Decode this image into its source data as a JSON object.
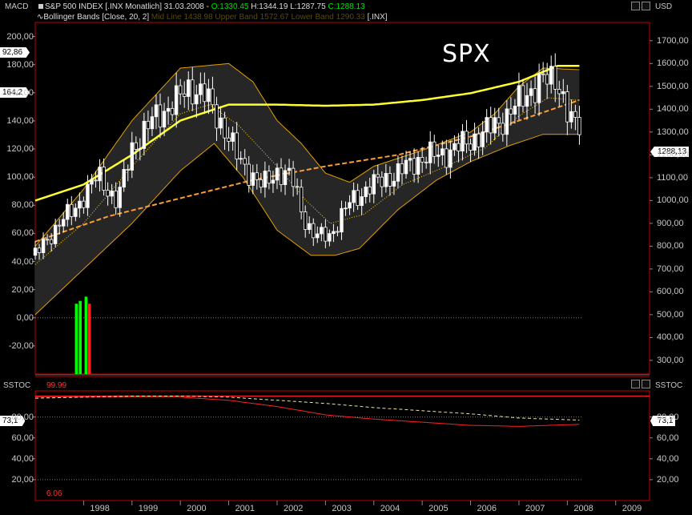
{
  "header": {
    "left_label": "MACD",
    "right_label": "USD",
    "symbol": "S&P 500 INDEX [.INX  Monatlich]",
    "date": "31.03.2008",
    "sep": "-",
    "open": "O:1330.45",
    "high": "H:1344.19",
    "low": "L:1287.75",
    "close": "C:1288.13",
    "indicator": "Bollinger Bands [Close, 20, 2]",
    "indicator_values": "Mid Line 1438.98 Upper Band 1572.67 Lower Band 1290.33",
    "indicator_sym": "[.INX]"
  },
  "chart_title": "SPX",
  "lower_panel": {
    "left_label": "SSTOC",
    "right_label": "SSTOC",
    "level_high": "99.99",
    "level_low": "6.06"
  },
  "tags": {
    "macd_top": "92,86",
    "macd_mid": "164,2",
    "price_last": "1288,13",
    "sstoc_left": "73,1",
    "sstoc_right": "73,1"
  },
  "colors": {
    "background": "#000000",
    "bb_upper": "#e0a000",
    "mid_line": "#ffd000",
    "ma_long": "#ffff30",
    "trend": "#ff9e30",
    "up_bar": "#00ff00",
    "down_bar": "#ff2020",
    "sstoc": "#ff2020",
    "sstoc_signal": "#f0e6a0"
  },
  "chart_data": [
    {
      "type": "candlestick",
      "title": "SPX",
      "xlabel": "",
      "ylabel": "USD",
      "x_ticks": [
        "1998",
        "1999",
        "2000",
        "2001",
        "2002",
        "2003",
        "2004",
        "2005",
        "2006",
        "2007",
        "2008",
        "2009"
      ],
      "y_ticks_right": [
        "1700,00",
        "1600,00",
        "1500,00",
        "1400,00",
        "1300,00",
        "1200,00",
        "1100,00",
        "1000,00",
        "900,00",
        "800,00",
        "700,00",
        "600,00",
        "500,00",
        "400,00",
        "300,00"
      ],
      "y_ticks_left": [
        "200,00",
        "180,00",
        "160,00",
        "140,00",
        "120,00",
        "100,00",
        "80,00",
        "60,00",
        "40,00",
        "20,00",
        "0,00",
        "-20,00"
      ],
      "ylim_right": [
        240,
        1780
      ],
      "ylim_left": [
        -40,
        210
      ],
      "close_anchors": [
        {
          "t": 1997.0,
          "v": 760
        },
        {
          "t": 1997.5,
          "v": 900
        },
        {
          "t": 1997.8,
          "v": 960
        },
        {
          "t": 1998.3,
          "v": 1110
        },
        {
          "t": 1998.7,
          "v": 990
        },
        {
          "t": 1999.0,
          "v": 1230
        },
        {
          "t": 1999.5,
          "v": 1370
        },
        {
          "t": 1999.9,
          "v": 1430
        },
        {
          "t": 2000.2,
          "v": 1500
        },
        {
          "t": 2000.5,
          "v": 1460
        },
        {
          "t": 2000.9,
          "v": 1320
        },
        {
          "t": 2001.2,
          "v": 1180
        },
        {
          "t": 2001.7,
          "v": 1060
        },
        {
          "t": 2002.0,
          "v": 1130
        },
        {
          "t": 2002.3,
          "v": 1100
        },
        {
          "t": 2002.6,
          "v": 900
        },
        {
          "t": 2002.8,
          "v": 840
        },
        {
          "t": 2003.1,
          "v": 850
        },
        {
          "t": 2003.5,
          "v": 990
        },
        {
          "t": 2003.9,
          "v": 1060
        },
        {
          "t": 2004.5,
          "v": 1120
        },
        {
          "t": 2004.9,
          "v": 1180
        },
        {
          "t": 2005.5,
          "v": 1210
        },
        {
          "t": 2005.9,
          "v": 1250
        },
        {
          "t": 2006.3,
          "v": 1300
        },
        {
          "t": 2006.8,
          "v": 1380
        },
        {
          "t": 2007.2,
          "v": 1480
        },
        {
          "t": 2007.5,
          "v": 1520
        },
        {
          "t": 2007.8,
          "v": 1540
        },
        {
          "t": 2008.0,
          "v": 1380
        },
        {
          "t": 2008.25,
          "v": 1288
        }
      ],
      "last": 1288.13,
      "bollinger": {
        "period": 20,
        "k": 2,
        "upper": [
          {
            "t": 1997.0,
            "v": 800
          },
          {
            "t": 1998.0,
            "v": 1050
          },
          {
            "t": 1999.0,
            "v": 1350
          },
          {
            "t": 2000.0,
            "v": 1580
          },
          {
            "t": 2001.0,
            "v": 1600
          },
          {
            "t": 2001.5,
            "v": 1520
          },
          {
            "t": 2002.0,
            "v": 1350
          },
          {
            "t": 2002.5,
            "v": 1250
          },
          {
            "t": 2003.0,
            "v": 1120
          },
          {
            "t": 2003.5,
            "v": 1080
          },
          {
            "t": 2004.0,
            "v": 1150
          },
          {
            "t": 2005.0,
            "v": 1220
          },
          {
            "t": 2006.0,
            "v": 1300
          },
          {
            "t": 2006.5,
            "v": 1380
          },
          {
            "t": 2007.0,
            "v": 1500
          },
          {
            "t": 2007.5,
            "v": 1580
          },
          {
            "t": 2008.25,
            "v": 1573
          }
        ],
        "mid": [
          {
            "t": 1997.0,
            "v": 720
          },
          {
            "t": 1998.0,
            "v": 900
          },
          {
            "t": 1999.0,
            "v": 1150
          },
          {
            "t": 2000.0,
            "v": 1380
          },
          {
            "t": 2000.6,
            "v": 1420
          },
          {
            "t": 2001.2,
            "v": 1330
          },
          {
            "t": 2002.0,
            "v": 1150
          },
          {
            "t": 2002.6,
            "v": 1000
          },
          {
            "t": 2003.1,
            "v": 900
          },
          {
            "t": 2003.8,
            "v": 940
          },
          {
            "t": 2004.6,
            "v": 1070
          },
          {
            "t": 2005.5,
            "v": 1150
          },
          {
            "t": 2006.3,
            "v": 1230
          },
          {
            "t": 2007.0,
            "v": 1370
          },
          {
            "t": 2007.6,
            "v": 1450
          },
          {
            "t": 2008.25,
            "v": 1439
          }
        ],
        "lower": [
          {
            "t": 1997.0,
            "v": 500
          },
          {
            "t": 1998.0,
            "v": 700
          },
          {
            "t": 1999.0,
            "v": 900
          },
          {
            "t": 2000.0,
            "v": 1130
          },
          {
            "t": 2000.7,
            "v": 1250
          },
          {
            "t": 2001.3,
            "v": 1100
          },
          {
            "t": 2002.0,
            "v": 870
          },
          {
            "t": 2002.7,
            "v": 760
          },
          {
            "t": 2003.2,
            "v": 760
          },
          {
            "t": 2003.7,
            "v": 790
          },
          {
            "t": 2004.5,
            "v": 960
          },
          {
            "t": 2005.3,
            "v": 1090
          },
          {
            "t": 2006.0,
            "v": 1170
          },
          {
            "t": 2006.8,
            "v": 1240
          },
          {
            "t": 2007.5,
            "v": 1290
          },
          {
            "t": 2008.25,
            "v": 1290
          }
        ]
      },
      "ma_long": [
        {
          "t": 1997.0,
          "v": 1000
        },
        {
          "t": 1998.0,
          "v": 1070
        },
        {
          "t": 1999.0,
          "v": 1200
        },
        {
          "t": 2000.0,
          "v": 1350
        },
        {
          "t": 2001.0,
          "v": 1420
        },
        {
          "t": 2002.0,
          "v": 1420
        },
        {
          "t": 2003.0,
          "v": 1415
        },
        {
          "t": 2004.0,
          "v": 1420
        },
        {
          "t": 2005.0,
          "v": 1440
        },
        {
          "t": 2006.0,
          "v": 1470
        },
        {
          "t": 2007.0,
          "v": 1520
        },
        {
          "t": 2007.8,
          "v": 1590
        },
        {
          "t": 2008.25,
          "v": 1590
        }
      ],
      "trend_line": [
        {
          "t": 1997.0,
          "v": 820
        },
        {
          "t": 1998.5,
          "v": 930
        },
        {
          "t": 2000.0,
          "v": 1010
        },
        {
          "t": 2001.5,
          "v": 1090
        },
        {
          "t": 2003.0,
          "v": 1150
        },
        {
          "t": 2004.5,
          "v": 1200
        },
        {
          "t": 2006.0,
          "v": 1280
        },
        {
          "t": 2007.0,
          "v": 1350
        },
        {
          "t": 2008.25,
          "v": 1440
        }
      ],
      "macd_histogram": [
        {
          "t": 1997.85,
          "v": 10,
          "color": "up"
        },
        {
          "t": 1997.93,
          "v": 12,
          "color": "up"
        },
        {
          "t": 1998.05,
          "v": 15,
          "color": "up"
        },
        {
          "t": 1998.12,
          "v": 10,
          "color": "down"
        }
      ]
    },
    {
      "type": "line",
      "title": "SSTOC",
      "ylim": [
        0,
        105
      ],
      "y_ticks": [
        "80,00",
        "60,00",
        "40,00",
        "20,00"
      ],
      "series": [
        {
          "color": "sstoc",
          "points": [
            {
              "t": 1997.0,
              "v": 99
            },
            {
              "t": 1999.0,
              "v": 99
            },
            {
              "t": 2000.0,
              "v": 99
            },
            {
              "t": 2001.0,
              "v": 96
            },
            {
              "t": 2002.0,
              "v": 90
            },
            {
              "t": 2003.0,
              "v": 82
            },
            {
              "t": 2004.0,
              "v": 78
            },
            {
              "t": 2005.0,
              "v": 75
            },
            {
              "t": 2006.0,
              "v": 72
            },
            {
              "t": 2007.0,
              "v": 71
            },
            {
              "t": 2008.25,
              "v": 73
            }
          ]
        },
        {
          "color": "sstoc_signal",
          "dashed": true,
          "points": [
            {
              "t": 1997.0,
              "v": 98
            },
            {
              "t": 1999.0,
              "v": 100
            },
            {
              "t": 2000.0,
              "v": 100
            },
            {
              "t": 2001.0,
              "v": 99
            },
            {
              "t": 2002.0,
              "v": 96
            },
            {
              "t": 2003.0,
              "v": 93
            },
            {
              "t": 2004.0,
              "v": 89
            },
            {
              "t": 2005.0,
              "v": 86
            },
            {
              "t": 2006.0,
              "v": 83
            },
            {
              "t": 2007.0,
              "v": 79
            },
            {
              "t": 2008.25,
              "v": 77
            }
          ]
        }
      ]
    }
  ]
}
